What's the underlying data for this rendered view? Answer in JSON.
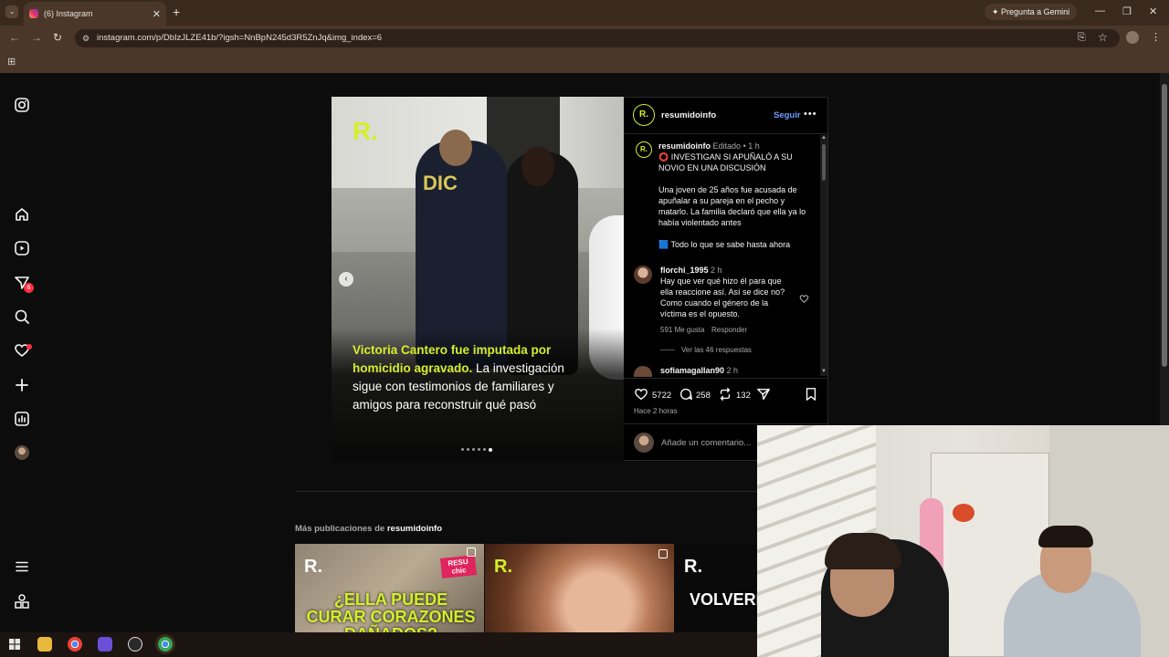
{
  "browser": {
    "tab_title": "(6) Instagram",
    "tab_close": "✕",
    "new_tab": "+",
    "url": "instagram.com/p/DbIzJLZE41b/?igsh=NnBpN245d3R5ZnJq&img_index=6",
    "gemini_label": "Pregunta a Gemini",
    "win_minimize": "—",
    "win_restore": "❐",
    "win_close": "✕"
  },
  "sidebar": {
    "icons": [
      "instagram-icon",
      "home-icon",
      "reels-icon",
      "messages-icon",
      "search-icon",
      "notifications-icon",
      "create-icon",
      "dashboard-icon",
      "profile-icon",
      "menu-icon",
      "threads-icon"
    ],
    "messages_badge": "6"
  },
  "post": {
    "media": {
      "brand_mark": "R.",
      "dic_label": "DIC",
      "caption_highlight": "Victoria Cantero fue imputada por homicidio agravado.",
      "caption_rest": " La investigación sigue con testimonios de familiares y amigos para reconstruir qué pasó",
      "carousel_count": 6,
      "carousel_active": 6
    },
    "header": {
      "avatar_text": "R.",
      "username": "resumidoinfo",
      "follow": "Seguir",
      "more": "•••"
    },
    "caption": {
      "username": "resumidoinfo",
      "edited": "Editado",
      "sep": "•",
      "time": "1 h",
      "line1": "⭕ INVESTIGAN SI APUÑALÓ A SU",
      "line2": "NOVIO EN UNA DISCUSIÓN",
      "p1_l1": "Una joven de 25 años fue acusada de",
      "p1_l2": "apuñalar a su pareja en el pecho y",
      "p1_l3": "matarlo. La familia declaró que ella ya lo",
      "p1_l4": "había violentado antes",
      "p2": "🟦 Todo lo que se sabe hasta ahora"
    },
    "comments": [
      {
        "username": "florchi_1995",
        "time": "2 h",
        "l1": "Hay que ver qué hizo él para que",
        "l2": "ella reaccione así. Así se dice no?",
        "l3": "Como cuando el género de la",
        "l4": "víctima es el opuesto.",
        "likes": "591 Me gusta",
        "reply": "Responder",
        "view_replies": "Ver las 46 respuestas"
      },
      {
        "username": "sofiamagallan90",
        "time": "2 h"
      }
    ],
    "actions": {
      "likes": "5722",
      "comments": "258",
      "reposts": "132"
    },
    "posted": "Hace 2 horas",
    "add_comment_placeholder": "Añade un comentario..."
  },
  "more_posts": {
    "label_prefix": "Más publicaciones de ",
    "label_user": "resumidoinfo",
    "thumbs": [
      {
        "brand": "R.",
        "badge": "RESU chic",
        "title": "¿ELLA PUEDE CURAR CORAZONES DAÑADOS?"
      },
      {
        "brand": "R."
      },
      {
        "brand": "R.",
        "title": "VOLVEREM AL DEMO"
      }
    ]
  },
  "colors": {
    "accent_blue": "#6f9cff",
    "brand_lime": "#d4ef2a",
    "badge_red": "#ff3040",
    "chrome_brown": "#4b3729"
  }
}
